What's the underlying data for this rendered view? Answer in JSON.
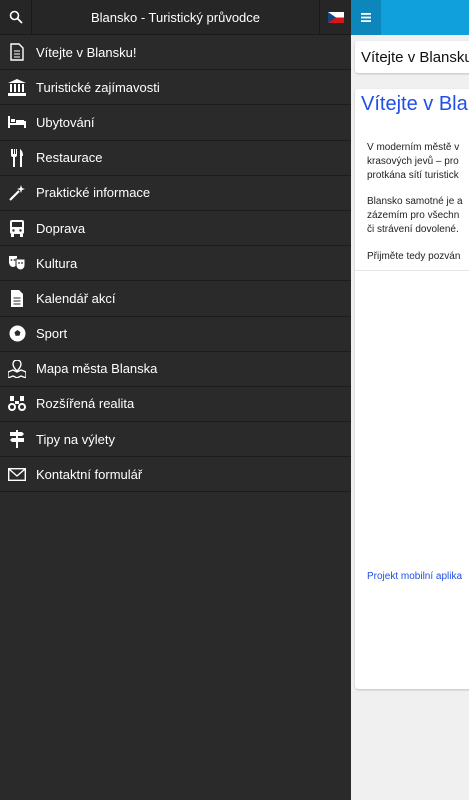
{
  "drawer": {
    "header_title": "Blansko - Turistický průvodce",
    "items": [
      {
        "label": "Vítejte v Blansku!",
        "icon": "document-icon"
      },
      {
        "label": "Turistické zajímavosti",
        "icon": "museum-icon"
      },
      {
        "label": "Ubytování",
        "icon": "bed-icon"
      },
      {
        "label": "Restaurace",
        "icon": "cutlery-icon"
      },
      {
        "label": "Praktické informace",
        "icon": "magic-wand-icon"
      },
      {
        "label": "Doprava",
        "icon": "bus-icon"
      },
      {
        "label": "Kultura",
        "icon": "theater-masks-icon"
      },
      {
        "label": "Kalendář akcí",
        "icon": "calendar-document-icon"
      },
      {
        "label": "Sport",
        "icon": "soccer-ball-icon"
      },
      {
        "label": "Mapa města Blanska",
        "icon": "map-icon"
      },
      {
        "label": "Rozšířená realita",
        "icon": "binoculars-icon"
      },
      {
        "label": "Tipy na výlety",
        "icon": "signpost-icon"
      },
      {
        "label": "Kontaktní formulář",
        "icon": "envelope-icon"
      }
    ]
  },
  "main": {
    "title_card": "Vítejte v Blansku!",
    "heading": "Vítejte v Blansku",
    "paragraphs": [
      "V moderním městě v",
      "krasových jevů – pro",
      "protkána sítí turistick",
      "Blansko samotné je a",
      "zázemím pro všechn",
      "či strávení dovolené.",
      "Přijměte tedy pozván"
    ],
    "footer_link": "Projekt mobilní aplika"
  },
  "colors": {
    "drawer_bg": "#2a2a2a",
    "topbar": "#10a0dc",
    "heading": "#2050e6"
  }
}
